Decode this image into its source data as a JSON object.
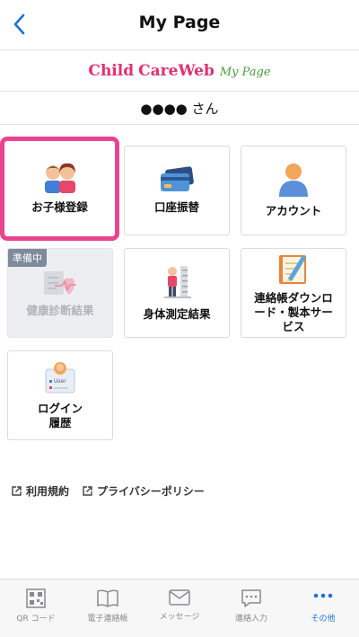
{
  "header": {
    "title": "My Page"
  },
  "brand": {
    "word1": "Child",
    "word2": "CareWeb",
    "word3": "My Page"
  },
  "user": {
    "name": "●●●●",
    "suffix": " さん"
  },
  "menu": {
    "children_registration": "お子様登録",
    "account_transfer": "口座振替",
    "account": "アカウント",
    "health_check": "健康診断結果",
    "preparing_badge": "準備中",
    "body_measurement": "身体測定結果",
    "notebook_download": "連絡帳ダウンロ\nード・製本サー\nビス",
    "login_history": "ログイン\n履歴",
    "login_history_icon_text": "User"
  },
  "links": {
    "terms": "利用規約",
    "privacy": "プライバシーポリシー"
  },
  "tabs": [
    {
      "label": "QR コード"
    },
    {
      "label": "電子連絡帳"
    },
    {
      "label": "メッセージ"
    },
    {
      "label": "連絡入力"
    },
    {
      "label": "その他"
    }
  ],
  "colors": {
    "accent": "#1a73d9",
    "highlight": "#e9448f",
    "brand_pink": "#e0306f",
    "brand_green": "#4a9a3e"
  }
}
